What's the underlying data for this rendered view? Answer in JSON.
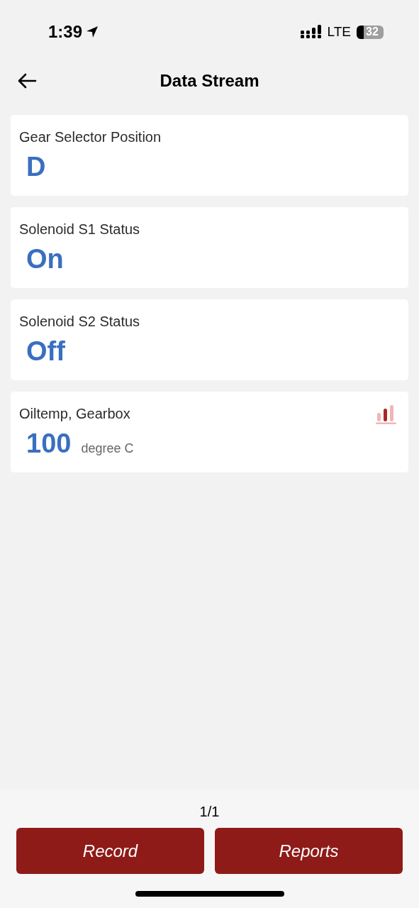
{
  "status_bar": {
    "time": "1:39",
    "network": "LTE",
    "battery": "32"
  },
  "header": {
    "title": "Data Stream"
  },
  "items": [
    {
      "label": "Gear Selector Position",
      "value": "D",
      "has_chart": false
    },
    {
      "label": "Solenoid S1 Status",
      "value": "On",
      "has_chart": false
    },
    {
      "label": "Solenoid S2 Status",
      "value": "Off",
      "has_chart": false
    },
    {
      "label": "Oiltemp, Gearbox",
      "value": "100",
      "unit": "degree C",
      "has_chart": true
    }
  ],
  "footer": {
    "page": "1/1",
    "buttons": [
      "Record",
      "Reports"
    ]
  }
}
